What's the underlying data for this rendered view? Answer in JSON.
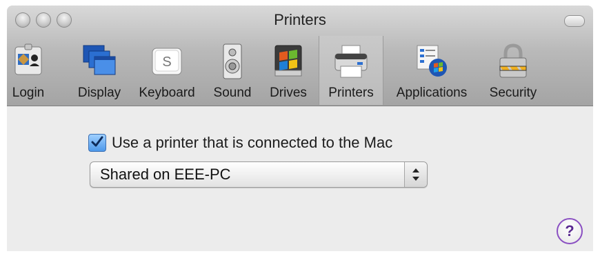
{
  "window": {
    "title": "Printers"
  },
  "toolbar": {
    "items": [
      {
        "label": "Login",
        "icon": "login-id-card-icon"
      },
      {
        "label": "Display",
        "icon": "display-windows-icon"
      },
      {
        "label": "Keyboard",
        "icon": "keyboard-key-icon"
      },
      {
        "label": "Sound",
        "icon": "speaker-icon"
      },
      {
        "label": "Drives",
        "icon": "drive-icon"
      },
      {
        "label": "Printers",
        "icon": "printer-icon",
        "selected": true
      },
      {
        "label": "Applications",
        "icon": "applications-icon"
      },
      {
        "label": "Security",
        "icon": "lock-icon"
      }
    ]
  },
  "printers": {
    "use_printer_label": "Use a printer that is connected to the Mac",
    "use_printer_checked": true,
    "share_select_value": "Shared on EEE-PC"
  },
  "help": {
    "label": "?"
  },
  "colors": {
    "selection_blue": "#4d98ea",
    "help_purple": "#8a4fc2"
  }
}
